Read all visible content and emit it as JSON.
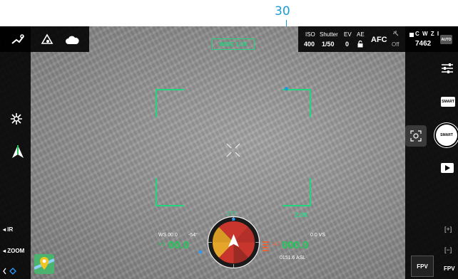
{
  "annotation": {
    "callout_number": "30"
  },
  "top_left": {
    "icons": [
      "drone-status-icon",
      "return-home-icon",
      "cloud-icon"
    ]
  },
  "top_right": {
    "iso_label": "ISO",
    "iso_value": "400",
    "shutter_label": "Shutter",
    "shutter_value": "1/50",
    "ev_label": "EV",
    "ev_value": "0",
    "ae_label": "AE",
    "focus_mode": "AFC",
    "light_value": "Off",
    "storage_label": "C W Z I",
    "storage_value": "7462",
    "camera_mode_label": "AUTO"
  },
  "view": {
    "zoom_mode": "WIDE 1.0X",
    "zoom_ratio": "2.0X"
  },
  "left_panel": {
    "ir_label": "IR",
    "zoom_label": "ZOOM"
  },
  "right_panel": {
    "smart_label_1": "SMART",
    "smart_label_2": "SMART",
    "fpv_label": "FPV",
    "fpv_small_label": "FPV"
  },
  "telemetry": {
    "ws_label": "WS 00.0",
    "angle_value": "-54°",
    "speed_value": "00.0",
    "speed_unit_prefix": "H.S",
    "vs_label": "0.0 VS",
    "altitude_value": "000.0",
    "altitude_prefix": "ALT",
    "asl_value": "0151.6 ASL",
    "heading_value": "277"
  },
  "colors": {
    "accent_green": "#22d57f",
    "warning_orange": "#ff5a1f",
    "callout_blue": "#1a9bd7"
  }
}
